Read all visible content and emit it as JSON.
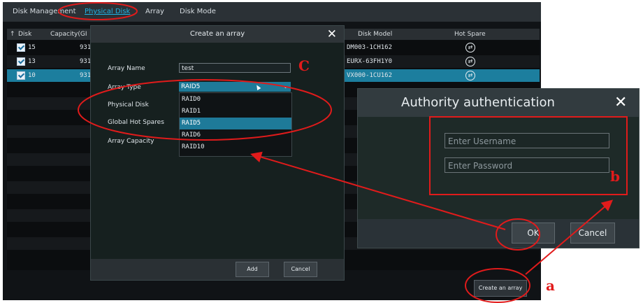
{
  "tabs": [
    "Disk Management",
    "Physical Disk",
    "Array",
    "Disk Mode"
  ],
  "grid": {
    "headers": {
      "disk": "Disk",
      "capacity": "Capacity(GI",
      "model": "Disk Model",
      "hotspare": "Hot Spare",
      "sort_icon": "up-arrow-icon"
    },
    "rows": [
      {
        "disk": "15",
        "capacity": "931",
        "model": "DM003-1CH162",
        "selected": false
      },
      {
        "disk": "13",
        "capacity": "931",
        "model": "EURX-63FH1Y0",
        "selected": false
      },
      {
        "disk": "10",
        "capacity": "931",
        "model": "VX000-1CU162",
        "selected": true
      }
    ]
  },
  "create_array_button": "Create an array",
  "dialog": {
    "title": "Create an array",
    "labels": {
      "array_name": "Array Name",
      "array_type": "Array Type",
      "physical_disk": "Physical Disk",
      "global_hot_spares": "Global Hot Spares",
      "array_capacity": "Array Capacity"
    },
    "array_name_value": "test",
    "array_type_value": "RAID5",
    "options": [
      "RAID0",
      "RAID1",
      "RAID5",
      "RAID6",
      "RAID10"
    ],
    "selected_option": "RAID5",
    "add_label": "Add",
    "cancel_label": "Cancel"
  },
  "auth": {
    "title": "Authority authentication",
    "username_placeholder": "Enter Username",
    "password_placeholder": "Enter Password",
    "ok_label": "OK",
    "cancel_label": "Cancel"
  },
  "annotations": {
    "a": "a",
    "b": "b",
    "c": "C"
  },
  "colors": {
    "accent": "#1e7a99",
    "tab_active": "#1fb4e6",
    "annotation": "#e11b1b"
  }
}
